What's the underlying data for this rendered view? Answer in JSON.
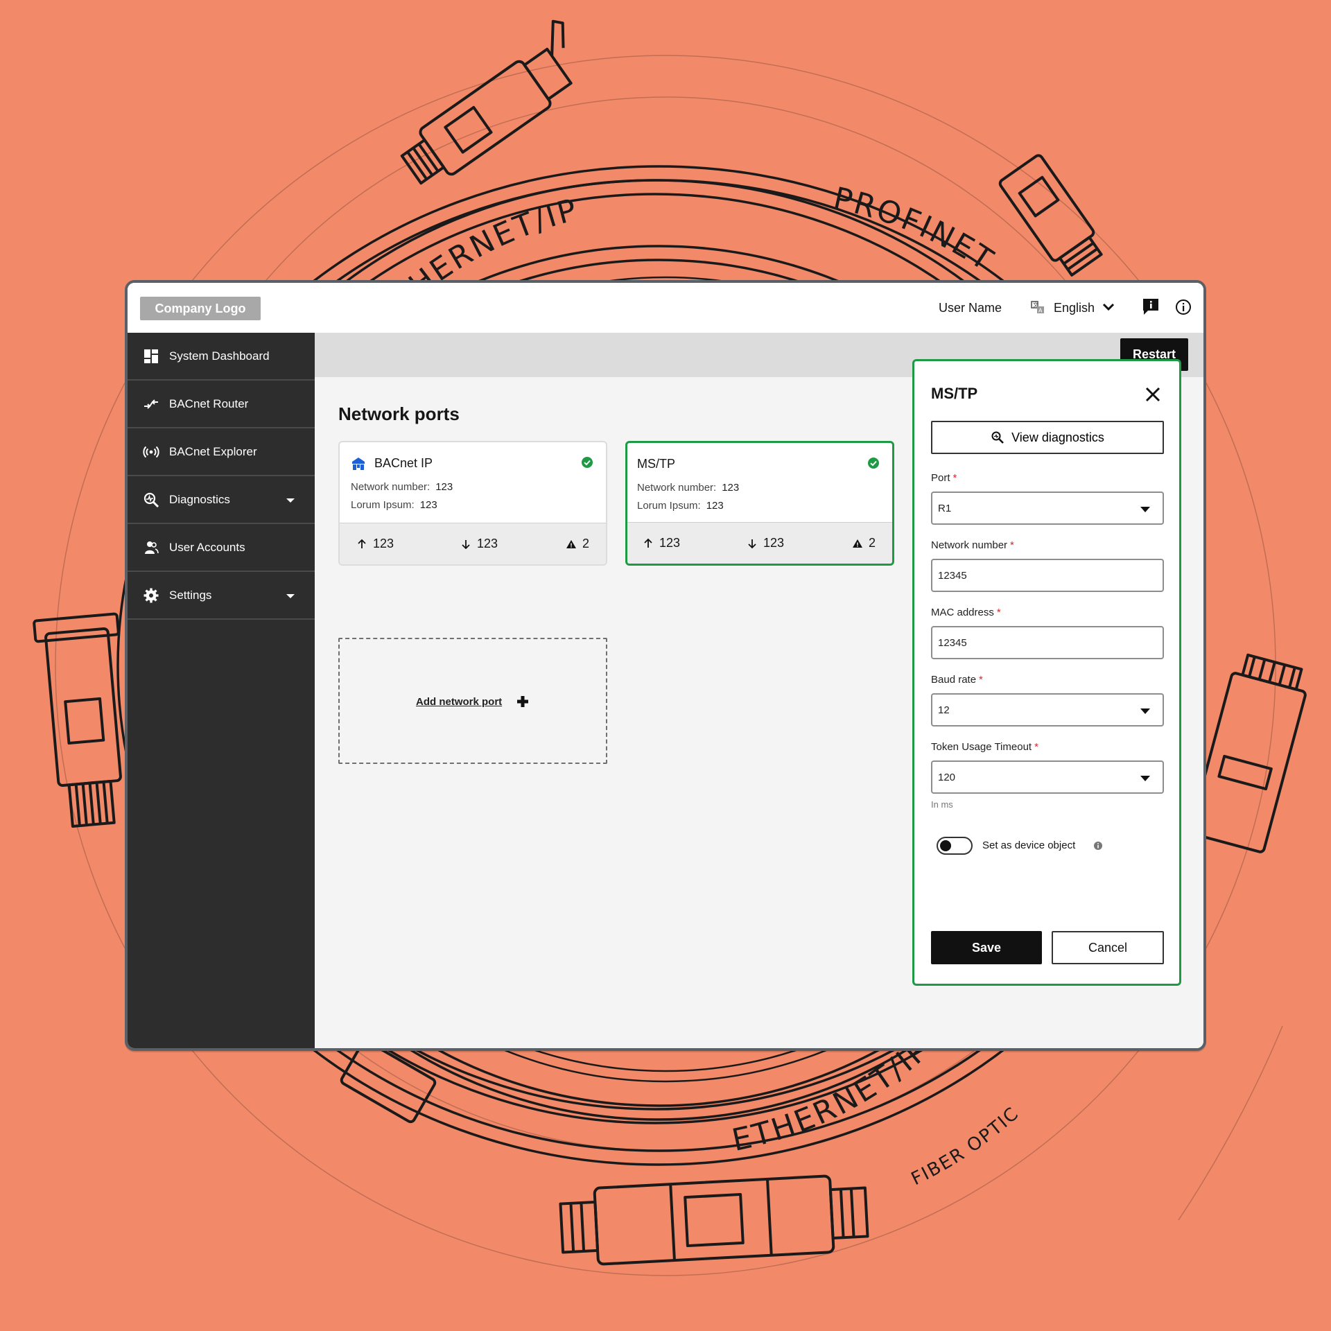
{
  "background": {
    "color": "#F28A6A",
    "cable_labels": [
      "ETHERNET/IP",
      "PROFINET",
      "ETHERNET/IP",
      "FIBER OPTIC"
    ]
  },
  "header": {
    "logo": "Company Logo",
    "user_name": "User Name",
    "language": "English",
    "icons": [
      "translate-icon",
      "chevron-down-icon",
      "feedback-icon",
      "info-icon"
    ]
  },
  "sidebar": {
    "items": [
      {
        "label": "System Dashboard",
        "icon": "dashboard-icon"
      },
      {
        "label": "BACnet Router",
        "icon": "router-icon"
      },
      {
        "label": "BACnet Explorer",
        "icon": "broadcast-icon"
      },
      {
        "label": "Diagnostics",
        "icon": "diagnostics-icon",
        "expandable": true
      },
      {
        "label": "User Accounts",
        "icon": "users-icon"
      },
      {
        "label": "Settings",
        "icon": "gear-icon",
        "expandable": true
      }
    ]
  },
  "toolbar": {
    "restart_label": "Restart"
  },
  "main": {
    "title": "Network ports",
    "cards": [
      {
        "title": "BACnet IP",
        "network_number_label": "Network number:",
        "network_number": "123",
        "lorum_label": "Lorum Ipsum:",
        "lorum_value": "123",
        "up": "123",
        "down": "123",
        "warnings": "2",
        "selected": false
      },
      {
        "title": "MS/TP",
        "network_number_label": "Network number:",
        "network_number": "123",
        "lorum_label": "Lorum Ipsum:",
        "lorum_value": "123",
        "up": "123",
        "down": "123",
        "warnings": "2",
        "selected": true
      }
    ],
    "add_port_label": "Add network port"
  },
  "panel": {
    "title": "MS/TP",
    "view_diagnostics": "View diagnostics",
    "fields": {
      "port": {
        "label": "Port",
        "value": "R1"
      },
      "network_number": {
        "label": "Network number",
        "value": "12345"
      },
      "mac_address": {
        "label": "MAC address",
        "value": "12345"
      },
      "baud_rate": {
        "label": "Baud rate",
        "value": "12"
      },
      "token_timeout": {
        "label": "Token Usage Timeout",
        "value": "120",
        "helper": "In ms"
      }
    },
    "required_mark": "*",
    "device_object_label": "Set as device object",
    "device_object_on": false,
    "save_label": "Save",
    "cancel_label": "Cancel"
  },
  "colors": {
    "accent_green": "#1F9A44",
    "sidebar": "#2D2D2D",
    "primary_button": "#111111",
    "brand_blue": "#1F5FD6",
    "required_red": "#D9262B"
  }
}
